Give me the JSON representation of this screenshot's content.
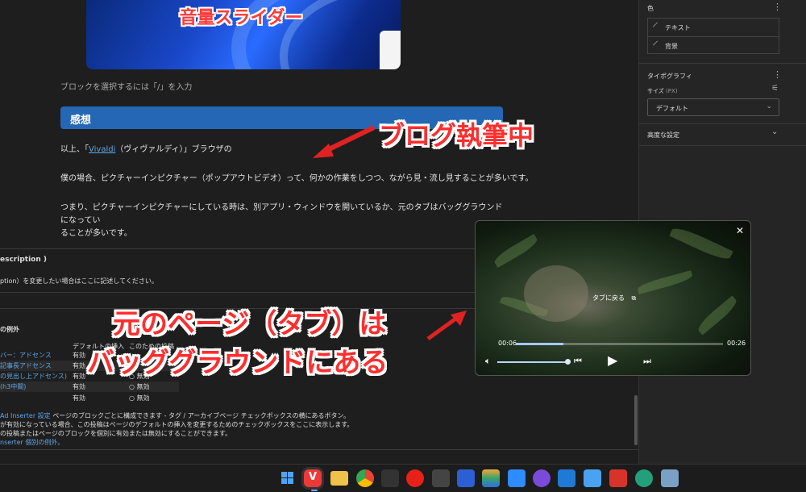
{
  "hero": {
    "title": "音量スライダー"
  },
  "editor": {
    "hint": "ブロックを選択するには「/」を入力",
    "heading": "感想",
    "p1_prefix": "以上、「",
    "p1_link": "Vivaldi",
    "p1_suffix": "（ヴィヴァルディ）」ブラウザの",
    "p2": "僕の場合、ピクチャーインピクチャー（ポップアウトビデオ）って、何かの作業をしつつ、ながら見・流し見することが多いです。",
    "p3_line1": "つまり、ピクチャーインピクチャーにしている時は、別アプリ・ウィンドウを開いているか、元のタブはバッググラウンドになってい",
    "p3_line2": "ることが多いです。"
  },
  "meta": {
    "description_title": "escription )",
    "description_note": "ption）を変更したい場合はここに記述してください。",
    "exceptions_title": "の例外",
    "col_default": "デフォルトの挿入",
    "col_this": "このための投稿",
    "rows": [
      {
        "key": "バー：アドセンス",
        "default": "有効",
        "this": ""
      },
      {
        "key": "記事長アドセンス",
        "default": "有効",
        "this": ""
      },
      {
        "key": "の見出し上アドセンス)",
        "default": "有効",
        "this": "無効"
      },
      {
        "key": "(h3中間)",
        "default": "有効",
        "this": "無効"
      },
      {
        "key": "",
        "default": "有効",
        "this": "無効"
      }
    ],
    "foot1_code": "Ad Inserter 設定",
    "foot1_text": " ページのブロックごとに構成できます - タグ / アーカイブページ チェックボックスの横にあるボタン。",
    "foot2": "が有効になっている場合、この投稿はページのデフォルトの挿入を変更するためのチェックボックスをここに表示します。",
    "foot3": "の投稿またはページのブロックを個別に有効または無効にすることができます。",
    "foot4": "nserter 個別の例外。"
  },
  "annotations": {
    "writing": "ブログ執筆中",
    "bg_line1": "元のページ（タブ）は",
    "bg_line2": "バッググラウンドにある"
  },
  "sidebar": {
    "color_label": "色",
    "text_item": "テキスト",
    "bg_item": "背景",
    "typography_label": "タイポグラフィ",
    "size_label": "サイズ",
    "size_unit": "(PX)",
    "size_value": "デフォルト",
    "advanced_label": "高度な設定"
  },
  "pip": {
    "back_to_tab": "タブに戻る",
    "time_current": "00:06",
    "time_total": "00:26",
    "progress": 0.23,
    "volume": 1.0
  },
  "taskbar": {
    "apps": [
      "windows-start",
      "vivaldi",
      "file-explorer",
      "chrome",
      "app-5",
      "youtube-music",
      "app-7",
      "app-8",
      "app-9",
      "zoom",
      "app-11",
      "vscode",
      "notepad",
      "app-14",
      "app-15",
      "app-16"
    ]
  }
}
